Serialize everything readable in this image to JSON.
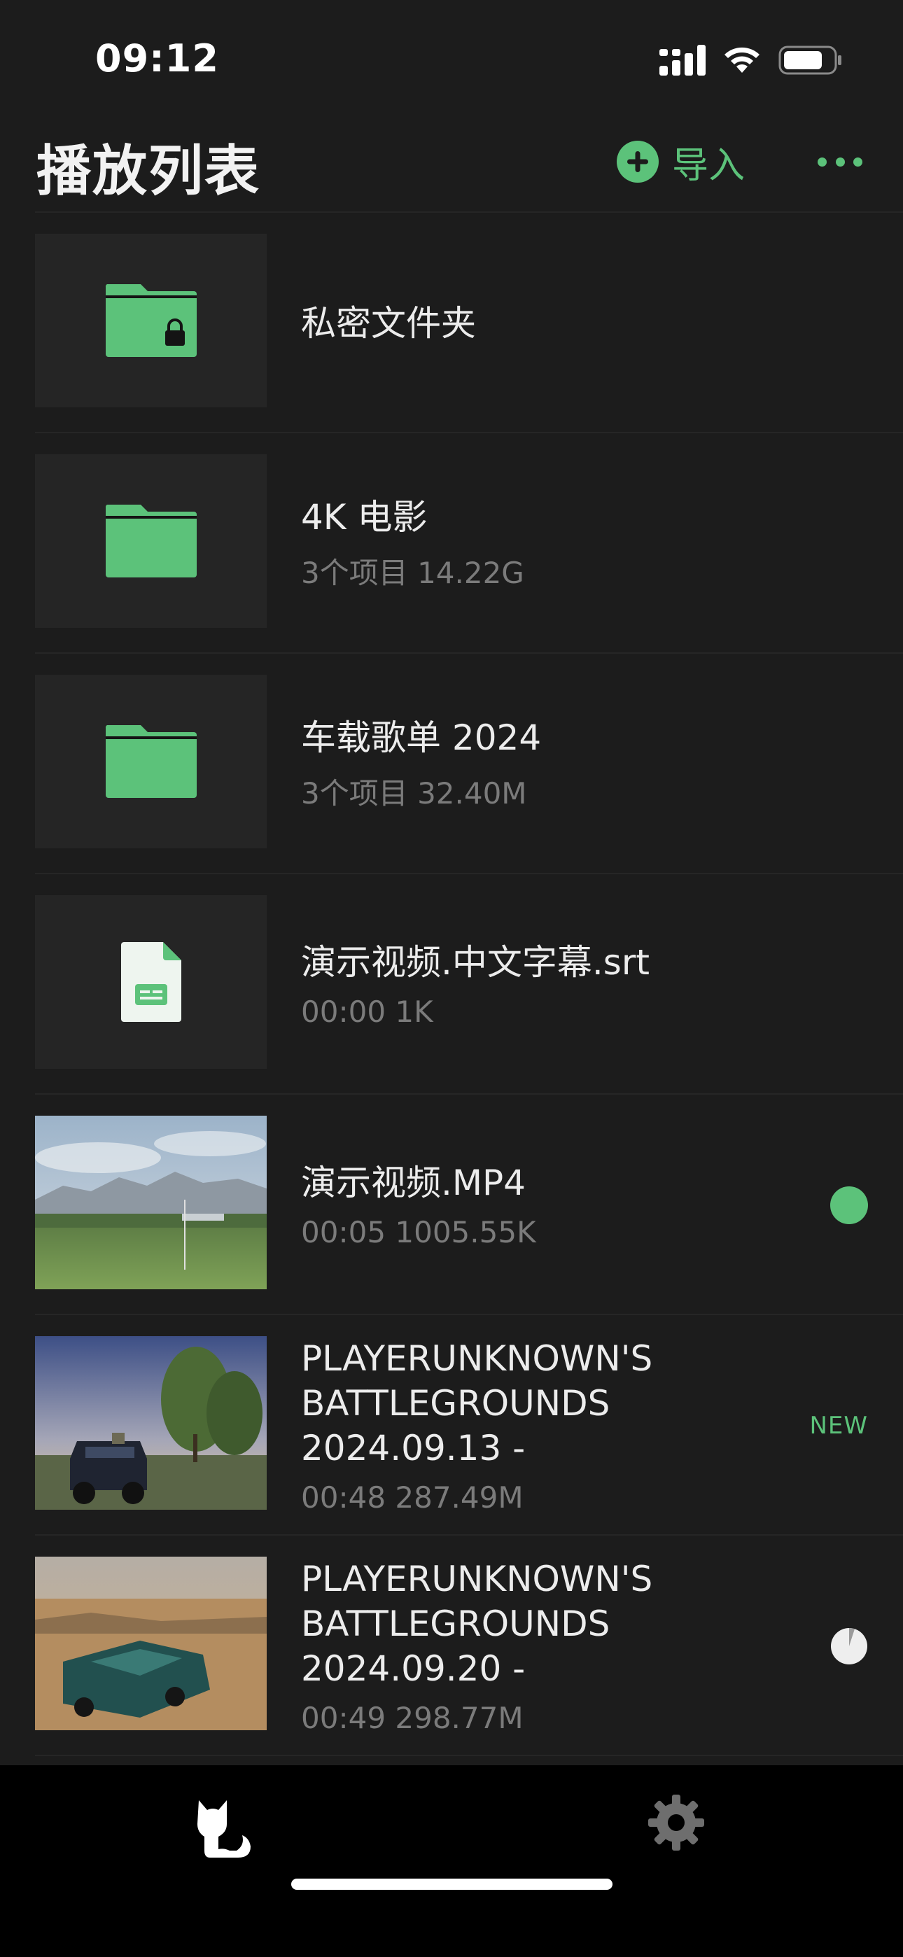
{
  "status_bar": {
    "time": "09:12"
  },
  "nav": {
    "title": "播放列表",
    "import_label": "导入"
  },
  "items": [
    {
      "title": "私密文件夹",
      "meta": "",
      "right": ""
    },
    {
      "title": "4K 电影",
      "meta": "3个项目 14.22G",
      "right": ""
    },
    {
      "title": "车载歌单 2024",
      "meta": "3个项目 32.40M",
      "right": ""
    },
    {
      "title": "演示视频.中文字幕.srt",
      "meta": "00:00 1K",
      "right": ""
    },
    {
      "title": "演示视频.MP4",
      "meta": "00:05 1005.55K",
      "right": ""
    },
    {
      "title": "PLAYERUNKNOWN'S BATTLEGROUNDS 2024.09.13 -",
      "meta": "00:48 287.49M",
      "right": "NEW"
    },
    {
      "title": "PLAYERUNKNOWN'S BATTLEGROUNDS 2024.09.20 -",
      "meta": "00:49 298.77M",
      "right": ""
    }
  ],
  "colors": {
    "accent": "#5cc27a",
    "background": "#1c1c1c",
    "thumb_bg": "#252525",
    "meta_text": "#7b7b7b"
  },
  "icons": [
    "signal-icon",
    "wifi-icon",
    "battery-icon",
    "plus-circle-icon",
    "more-icon",
    "locked-folder-icon",
    "folder-icon",
    "subtitle-file-icon",
    "cat-icon",
    "gear-icon"
  ]
}
